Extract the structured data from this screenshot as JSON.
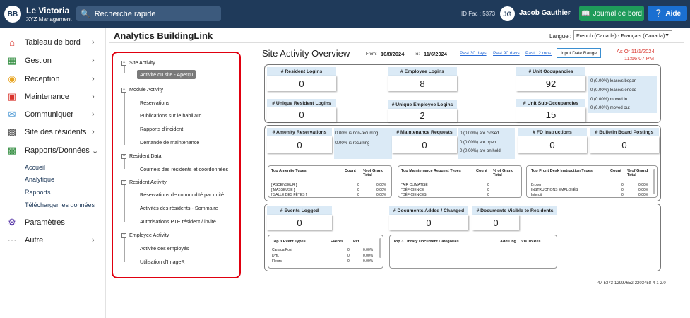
{
  "header": {
    "logo_text": "BB",
    "brand_name": "Le Victoria",
    "brand_sub": "XYZ Management",
    "search_label": "Recherche rapide",
    "id_fac": "ID Fac : 5373",
    "avatar_initials": "JG",
    "user_name": "Jacob Gauthier",
    "journal_button": "Journal de bord",
    "aide_button": "Aide"
  },
  "sidebar": {
    "items": [
      {
        "label": "Tableau de bord",
        "icon": "home-icon"
      },
      {
        "label": "Gestion",
        "icon": "grid-icon"
      },
      {
        "label": "Réception",
        "icon": "bell-icon"
      },
      {
        "label": "Maintenance",
        "icon": "toolbox-icon"
      },
      {
        "label": "Communiquer",
        "icon": "mail-icon"
      },
      {
        "label": "Site des résidents",
        "icon": "monitor-icon"
      },
      {
        "label": "Rapports/Données",
        "icon": "bar-chart-icon"
      },
      {
        "label": "Paramètres",
        "icon": "gear-icon"
      },
      {
        "label": "Autre",
        "icon": "more-icon"
      }
    ],
    "reports_sub": [
      "Accueil",
      "Analytique",
      "Rapports",
      "Télécharger les données"
    ]
  },
  "main": {
    "title": "Analytics BuildingLink",
    "language_label": "Langue :",
    "language_value": "French (Canada) - Français (Canada)"
  },
  "tree": {
    "groups": [
      {
        "label": "Site Activity",
        "children": [
          "Activité du site - Aperçu"
        ]
      },
      {
        "label": "Module Activity",
        "children": [
          "Réservations",
          "Publications sur le babillard",
          "Rapports d'incident",
          "Demande de maintenance"
        ]
      },
      {
        "label": "Resident Data",
        "children": [
          "Courriels des résidents et coordonnées"
        ]
      },
      {
        "label": "Resident Activity",
        "children": [
          "Réservations de commodité par unité",
          "Activités des résidents - Sommaire",
          "Autorisations PTE résident / invité"
        ]
      },
      {
        "label": "Employee Activity",
        "children": [
          "Activité des employés",
          "Utilisation d'ImageR"
        ]
      }
    ]
  },
  "overview": {
    "title": "Site Activity Overview",
    "from_label": "From:",
    "from_value": "10/8/2024",
    "to_label": "To:",
    "to_value": "11/6/2024",
    "links": [
      "Past 30 days",
      "Past 90 days",
      "Past 12 mos."
    ],
    "input_range_button": "Input Date Range",
    "as_of_line1": "As Of 11/1/2024",
    "as_of_line2": "11:56:07 PM",
    "kpis": {
      "resident_logins": {
        "label": "# Resident Logins",
        "value": "0"
      },
      "employee_logins": {
        "label": "# Employee Logins",
        "value": "8"
      },
      "unit_occupancies": {
        "label": "# Unit Occupancies",
        "value": "92"
      },
      "unique_resident_logins": {
        "label": "# Unique Resident Logins",
        "value": "0"
      },
      "unique_employee_logins": {
        "label": "# Unique Employee Logins",
        "value": "2"
      },
      "unit_sub_occupancies": {
        "label": "# Unit Sub-Occupancies",
        "value": "15"
      },
      "amenity_reservations": {
        "label": "# Amenity Reservations",
        "value": "0"
      },
      "maintenance_requests": {
        "label": "# Maintenance Requests",
        "value": "0"
      },
      "fd_instructions": {
        "label": "# FD Instructions",
        "value": "0"
      },
      "bulletin_posts": {
        "label": "# Bulletin Board Postings",
        "value": "0"
      },
      "events_logged": {
        "label": "# Events Logged",
        "value": "0"
      },
      "documents_added": {
        "label": "# Documents Added / Changed",
        "value": "0"
      },
      "documents_visible": {
        "label": "# Documents Visible to Residents",
        "value": "0"
      }
    },
    "occupancy_notes": [
      "0 (0.00%) lease/s began",
      "0 (0.00%) lease/s ended",
      "0 (0.00%) moved in",
      "0 (0.00%) moved out"
    ],
    "amenity_notes": [
      "0.00% is non-recurring",
      "0.00% is recurring"
    ],
    "maintenance_notes": [
      "0 (0.00%) are closed",
      "0 (0.00%) are open",
      "0 (0.00%) are on hold"
    ],
    "top_amenity": {
      "title": "Top Amenity Types",
      "col1": "Count",
      "col2": "% of Grand Total",
      "rows": [
        [
          "[ ASCENSEUR ]",
          "0",
          "0.00%"
        ],
        [
          "[ MASSEUSE ]",
          "0",
          "0.00%"
        ],
        [
          "[ SALLE DES FÊTES ]",
          "0",
          "0.00%"
        ]
      ]
    },
    "top_maintenance": {
      "title": "Top Maintenance Request Types",
      "col1": "Count",
      "col2": "% of Grand Total",
      "rows": [
        [
          "*AIR CLIMATISÉ",
          "0",
          ""
        ],
        [
          "*DÉFICIENCE",
          "0",
          ""
        ],
        [
          "*DÉFICIENCES",
          "0",
          ""
        ]
      ]
    },
    "top_frontdesk": {
      "title": "Top Front Desk Instruction Types",
      "col1": "Count",
      "col2": "% of Grand Total",
      "rows": [
        [
          "Broker",
          "0",
          "0.00%"
        ],
        [
          "INSTRUCTIONS EMPLOYÉS",
          "0",
          "0.00%"
        ],
        [
          "Interdit",
          "0",
          "0.00%"
        ]
      ]
    },
    "top_events": {
      "title": "Top 3 Event Types",
      "col1": "Events",
      "col2": "Pct",
      "rows": [
        [
          "Canada Post",
          "0",
          "0.00%"
        ],
        [
          "DHL",
          "0",
          "0.00%"
        ],
        [
          "Fleurs",
          "0",
          "0.00%"
        ]
      ]
    },
    "top_library": {
      "title": "Top 3 Library Document Categories",
      "col1": "Add/Chg",
      "col2": "Vis To Res"
    },
    "footer_id": "47-5373-12997652-2203458-4-1 2.0"
  }
}
